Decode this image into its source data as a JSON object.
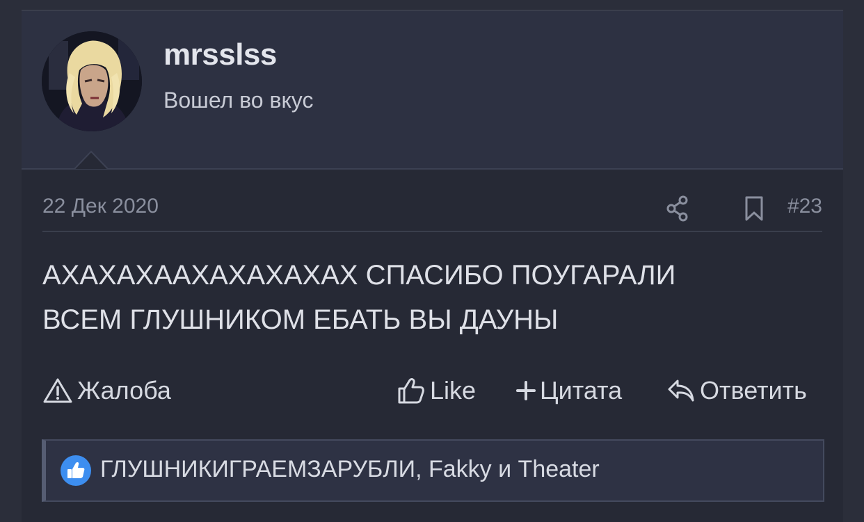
{
  "user": {
    "username": "mrsslss",
    "title": "Вошел во вкус"
  },
  "post": {
    "date": "22 Дек 2020",
    "number": "#23",
    "message_lines": [
      "АХАХАХААХАХАХАХАХ СПАСИБО ПОУГАРАЛИ",
      "ВСЕМ ГЛУШНИКОМ ЕБАТЬ ВЫ ДАУНЫ"
    ]
  },
  "actions": {
    "report": "Жалоба",
    "like": "Like",
    "quote": "Цитата",
    "reply": "Ответить"
  },
  "reactions": {
    "text": "ГЛУШНИКИГРАЕМЗАРУБЛИ, Fakky и Theater"
  },
  "icons": {
    "share": "share-icon",
    "bookmark": "bookmark-icon",
    "report": "warning-triangle-icon",
    "like": "thumbs-up-icon",
    "quote": "plus-icon",
    "reply": "reply-arrow-icon",
    "like_badge": "like-badge-icon"
  },
  "colors": {
    "background": "#2b2e3a",
    "header": "#2d3142",
    "post_body": "#262935",
    "like_badge": "#3d8ef0"
  }
}
